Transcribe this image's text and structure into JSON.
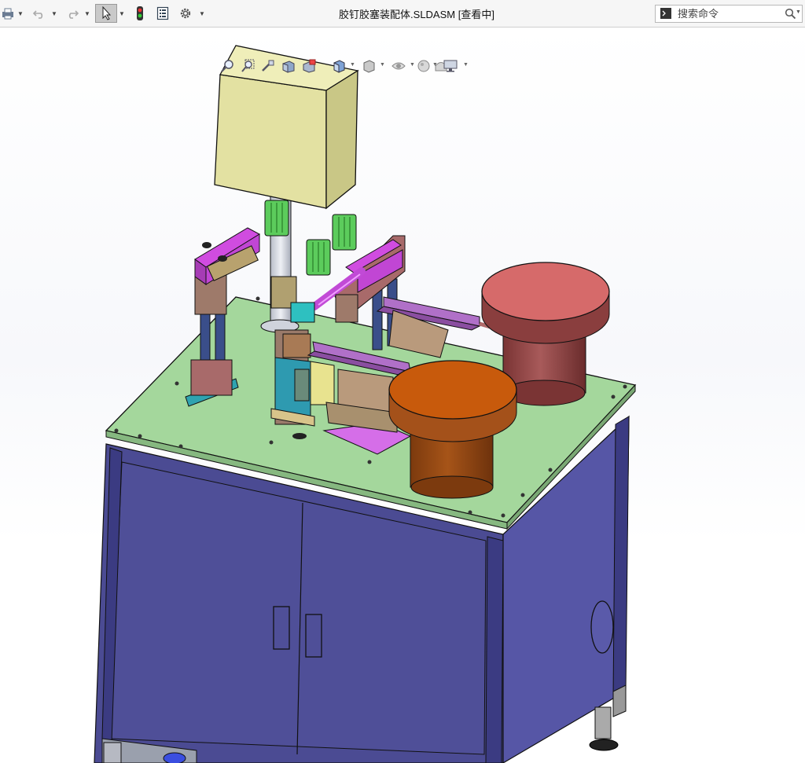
{
  "window": {
    "title": "胶钉胶塞装配体.SLDASM [查看中]"
  },
  "toolbar": {
    "items": [
      {
        "name": "print-button",
        "icon": "printer-icon"
      },
      {
        "name": "undo-button",
        "icon": "undo-icon"
      },
      {
        "name": "redo-button",
        "icon": "redo-icon"
      },
      {
        "name": "select-button",
        "icon": "cursor-arrow-icon"
      },
      {
        "name": "rebuild-button",
        "icon": "traffic-light-icon"
      },
      {
        "name": "file-properties-button",
        "icon": "properties-icon"
      },
      {
        "name": "options-button",
        "icon": "gear-icon"
      }
    ]
  },
  "search": {
    "placeholder": "搜索命令",
    "value": ""
  },
  "heads_up_toolbar": [
    "zoom-to-fit-icon",
    "zoom-to-area-icon",
    "previous-view-icon",
    "section-view-icon",
    "dynamic-annotation-icon",
    "view-orientation-icon",
    "display-style-icon",
    "hide-show-items-icon",
    "edit-appearance-icon",
    "apply-scene-icon",
    "view-settings-icon"
  ],
  "colors": {
    "cabinet": "#4f4f9a",
    "cabinet_dark": "#3e3e86",
    "table_top": "#a9d9a0",
    "control_box": "#e6e4a6",
    "bowl_red": "#d96c6c",
    "bowl_red_dark": "#a84e4e",
    "bowl_orange": "#c96a1f",
    "bowl_orange_dark": "#a4511a",
    "magenta_parts": "#c04bd6",
    "green_cylinders": "#5fcf5f"
  }
}
